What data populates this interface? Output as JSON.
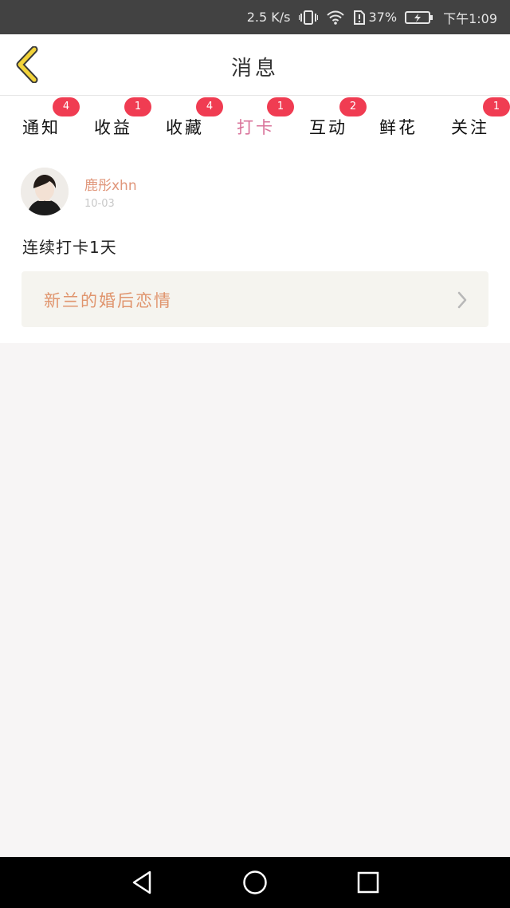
{
  "status_bar": {
    "net_speed": "2.5 K/s",
    "battery_percent": "37%",
    "time": "下午1:09",
    "icons": [
      "vibrate-icon",
      "wifi-icon",
      "sim-alert-icon",
      "battery-charging-icon"
    ]
  },
  "header": {
    "title": "消息",
    "back_icon": "chevron-left-icon"
  },
  "tabs": [
    {
      "label": "通知",
      "badge": "4",
      "active": false
    },
    {
      "label": "收益",
      "badge": "1",
      "active": false
    },
    {
      "label": "收藏",
      "badge": "4",
      "active": false
    },
    {
      "label": "打卡",
      "badge": "1",
      "active": true
    },
    {
      "label": "互动",
      "badge": "2",
      "active": false
    },
    {
      "label": "鲜花",
      "badge": "",
      "active": false
    },
    {
      "label": "关注",
      "badge": "1",
      "active": false
    }
  ],
  "post": {
    "username": "鹿彤xhn",
    "date": "10-03",
    "text": "连续打卡1天",
    "book_title": "新兰的婚后恋情",
    "chevron_icon": "chevron-right-icon"
  },
  "nav_bar": {
    "back_icon": "triangle-back-icon",
    "home_icon": "circle-home-icon",
    "recents_icon": "square-recents-icon"
  },
  "colors": {
    "accent_pink": "#e07aa0",
    "badge_red": "#f03c52",
    "username_orange": "#e0967a",
    "book_title_orange": "#e0956e",
    "back_icon_yellow": "#f2d33a"
  }
}
